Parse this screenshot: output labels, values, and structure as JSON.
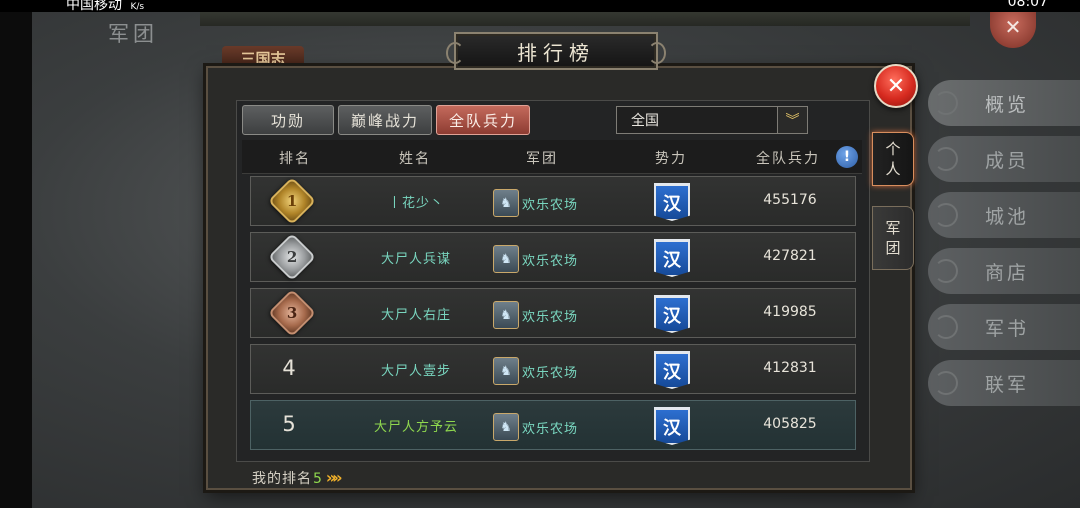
{
  "status_bar": {
    "carrier": "中国移动",
    "speed_unit": "K/s",
    "time": "08:07"
  },
  "background": {
    "section_title": "军团",
    "logo_text": "三国志",
    "close_glyph": "✕"
  },
  "side_menu": [
    {
      "label": "概览"
    },
    {
      "label": "成员"
    },
    {
      "label": "城池"
    },
    {
      "label": "商店"
    },
    {
      "label": "军书"
    },
    {
      "label": "联军"
    }
  ],
  "panel": {
    "title": "排行榜",
    "close_glyph": "✕"
  },
  "tabs": [
    {
      "label": "功勋",
      "active": false
    },
    {
      "label": "巅峰战力",
      "active": false
    },
    {
      "label": "全队兵力",
      "active": true
    }
  ],
  "region_select": {
    "value": "全国",
    "arrow": "︾"
  },
  "side_tabs": [
    {
      "label_top": "个",
      "label_bottom": "人",
      "active": true
    },
    {
      "label_top": "军",
      "label_bottom": "团",
      "active": false
    }
  ],
  "table": {
    "headers": {
      "rank": "排名",
      "name": "姓名",
      "legion": "军团",
      "faction": "势力",
      "troops": "全队兵力"
    },
    "info_glyph": "!",
    "rows": [
      {
        "rank": "1",
        "medal": "gold",
        "name": "丨花少丶",
        "legion_icon": "♞",
        "legion": "欢乐农场",
        "faction": "汉",
        "troops": "455176"
      },
      {
        "rank": "2",
        "medal": "silver",
        "name": "大尸人兵谋",
        "legion_icon": "♞",
        "legion": "欢乐农场",
        "faction": "汉",
        "troops": "427821"
      },
      {
        "rank": "3",
        "medal": "bronze",
        "name": "大尸人右庄",
        "legion_icon": "♞",
        "legion": "欢乐农场",
        "faction": "汉",
        "troops": "419985"
      },
      {
        "rank": "4",
        "medal": "",
        "name": "大尸人壹步",
        "legion_icon": "♞",
        "legion": "欢乐农场",
        "faction": "汉",
        "troops": "412831"
      },
      {
        "rank": "5",
        "medal": "",
        "name": "大尸人方予云",
        "legion_icon": "♞",
        "legion": "欢乐农场",
        "faction": "汉",
        "troops": "405825"
      }
    ]
  },
  "my_rank": {
    "label": "我的排名",
    "value": "5",
    "chevron": "»»"
  }
}
